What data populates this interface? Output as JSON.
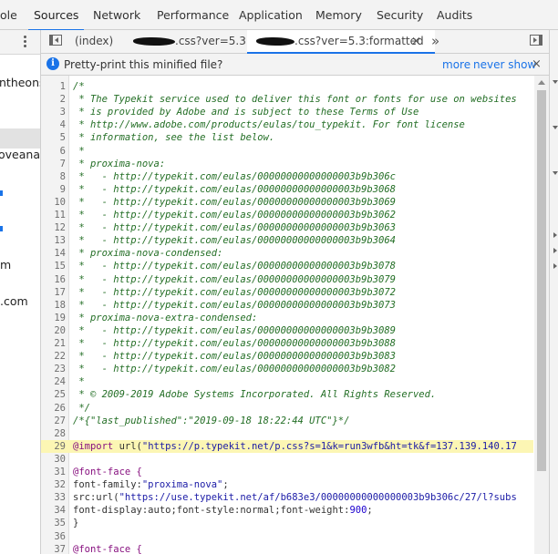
{
  "top_tabs": [
    "ole",
    "Sources",
    "Network",
    "Performance",
    "Application",
    "Memory",
    "Security",
    "Audits"
  ],
  "top_tabs_active": "Sources",
  "navigator": {
    "items": [
      "ntheonsi",
      "oveanaly",
      "m",
      ".com"
    ]
  },
  "editor_tabs": {
    "index_label": "(index)",
    "tab2_suffix": ".css?ver=5.3",
    "tab3_suffix": ".css?ver=5.3:formatted",
    "close_glyph": "×",
    "more_glyph": "»"
  },
  "infobar": {
    "message": "Pretty-print this minified file?",
    "more": "more",
    "never_show": "never show",
    "close_glyph": "×"
  },
  "code": {
    "line_numbers": [
      "1",
      "2",
      "3",
      "4",
      "5",
      "6",
      "7",
      "8",
      "9",
      "10",
      "11",
      "12",
      "13",
      "14",
      "15",
      "16",
      "17",
      "18",
      "19",
      "20",
      "21",
      "22",
      "23",
      "24",
      "25",
      "26",
      "27",
      "28",
      "29",
      "30",
      "31",
      "32",
      "33",
      "34",
      "35",
      "36",
      "37"
    ],
    "highlighted_line": "29",
    "text": {
      "c1": "/*",
      "c2": " * The Typekit service used to deliver this font or fonts for use on websites",
      "c3": " * is provided by Adobe and is subject to these Terms of Use",
      "c4": " * http://www.adobe.com/products/eulas/tou_typekit. For font license",
      "c5": " * information, see the list below.",
      "c6": " *",
      "c7": " * proxima-nova:",
      "c8": " *   - http://typekit.com/eulas/00000000000000003b9b306c",
      "c9": " *   - http://typekit.com/eulas/00000000000000003b9b3068",
      "c10": " *   - http://typekit.com/eulas/00000000000000003b9b3069",
      "c11": " *   - http://typekit.com/eulas/00000000000000003b9b3062",
      "c12": " *   - http://typekit.com/eulas/00000000000000003b9b3063",
      "c13": " *   - http://typekit.com/eulas/00000000000000003b9b3064",
      "c14": " * proxima-nova-condensed:",
      "c15": " *   - http://typekit.com/eulas/00000000000000003b9b3078",
      "c16": " *   - http://typekit.com/eulas/00000000000000003b9b3079",
      "c17": " *   - http://typekit.com/eulas/00000000000000003b9b3072",
      "c18": " *   - http://typekit.com/eulas/00000000000000003b9b3073",
      "c19": " * proxima-nova-extra-condensed:",
      "c20": " *   - http://typekit.com/eulas/00000000000000003b9b3089",
      "c21": " *   - http://typekit.com/eulas/00000000000000003b9b3088",
      "c22": " *   - http://typekit.com/eulas/00000000000000003b9b3083",
      "c23": " *   - http://typekit.com/eulas/00000000000000003b9b3082",
      "c24": " *",
      "c25": " * © 2009-2019 Adobe Systems Incorporated. All Rights Reserved.",
      "c26": " */",
      "c27": "/*{\"last_published\":\"2019-09-18 18:22:44 UTC\"}*/",
      "l29_at": "@import",
      "l29_kw": " url(",
      "l29_str": "\"https://p.typekit.net/p.css?s=1&k=run3wfb&ht=tk&f=137.139.140.17",
      "l31": "@font-face {",
      "l32_prop": "font-family:",
      "l32_val": "\"proxima-nova\"",
      "l32_end": ";",
      "l33_prop": "src:url(",
      "l33_val": "\"https://use.typekit.net/af/b683e3/00000000000000003b9b306c/27/l?subs",
      "l34_a": "font-display:auto;font-style:normal;font-weight:",
      "l34_num": "900",
      "l34_end": ";",
      "l35": "}",
      "l37": "@font-face {"
    }
  }
}
